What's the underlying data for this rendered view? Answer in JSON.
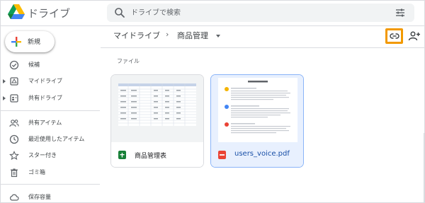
{
  "app": {
    "title": "ドライブ"
  },
  "search": {
    "placeholder": "ドライブで検索"
  },
  "sidebar": {
    "new_label": "新規",
    "items": [
      {
        "label": "候補"
      },
      {
        "label": "マイドライブ"
      },
      {
        "label": "共有ドライブ"
      },
      {
        "label": "共有アイテム"
      },
      {
        "label": "最近使用したアイテム"
      },
      {
        "label": "スター付き"
      },
      {
        "label": "ゴミ箱"
      },
      {
        "label": "保存容量"
      }
    ]
  },
  "breadcrumb": {
    "root": "マイドライブ",
    "separator": "›",
    "current": "商品管理"
  },
  "files": {
    "section_label": "ファイル",
    "items": [
      {
        "name": "商品管理表",
        "type": "spreadsheet",
        "selected": false
      },
      {
        "name": "users_voice.pdf",
        "type": "pdf",
        "selected": true
      }
    ]
  },
  "colors": {
    "highlight": "#f29900",
    "accent_blue": "#1a73e8",
    "sheets_green": "#188038",
    "pdf_red": "#ea4335"
  },
  "icons": {
    "logo": "drive-logo",
    "search": "search-icon",
    "tune": "tune-icon",
    "link": "link-icon",
    "share": "add-person-icon"
  }
}
